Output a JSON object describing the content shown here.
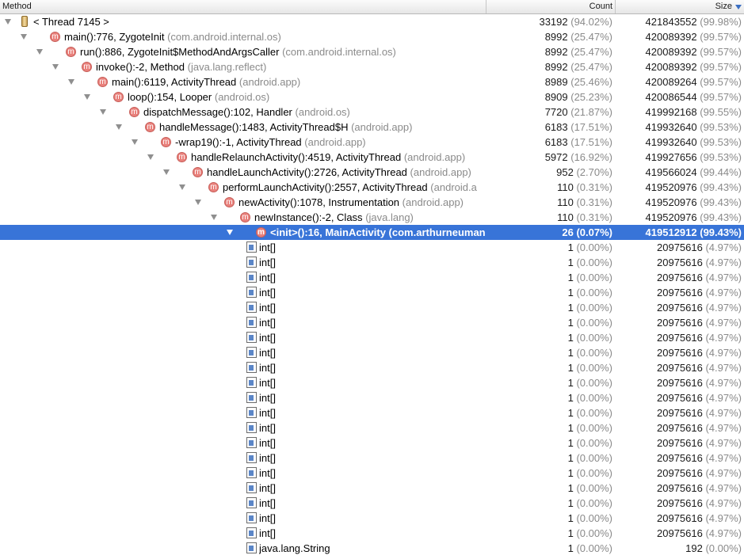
{
  "header": {
    "method": "Method",
    "count": "Count",
    "size": "Size"
  },
  "rows": [
    {
      "level": 0,
      "expanded": true,
      "icon": "thread-icon",
      "name": "< Thread 7145 >",
      "pkg": "",
      "count": "33192",
      "count_pct": "(94.02%)",
      "size": "421843552",
      "size_pct": "(99.98%)"
    },
    {
      "level": 1,
      "expanded": true,
      "icon": "method-icon",
      "name": "main():776, ZygoteInit",
      "pkg": "(com.android.internal.os)",
      "count": "8992",
      "count_pct": "(25.47%)",
      "size": "420089392",
      "size_pct": "(99.57%)"
    },
    {
      "level": 2,
      "expanded": true,
      "icon": "method-icon",
      "name": "run():886, ZygoteInit$MethodAndArgsCaller",
      "pkg": "(com.android.internal.os)",
      "count": "8992",
      "count_pct": "(25.47%)",
      "size": "420089392",
      "size_pct": "(99.57%)"
    },
    {
      "level": 3,
      "expanded": true,
      "icon": "method-icon",
      "name": "invoke():-2, Method",
      "pkg": "(java.lang.reflect)",
      "count": "8992",
      "count_pct": "(25.47%)",
      "size": "420089392",
      "size_pct": "(99.57%)"
    },
    {
      "level": 4,
      "expanded": true,
      "icon": "method-icon",
      "name": "main():6119, ActivityThread",
      "pkg": "(android.app)",
      "count": "8989",
      "count_pct": "(25.46%)",
      "size": "420089264",
      "size_pct": "(99.57%)"
    },
    {
      "level": 5,
      "expanded": true,
      "icon": "method-icon",
      "name": "loop():154, Looper",
      "pkg": "(android.os)",
      "count": "8909",
      "count_pct": "(25.23%)",
      "size": "420086544",
      "size_pct": "(99.57%)"
    },
    {
      "level": 6,
      "expanded": true,
      "icon": "method-icon",
      "name": "dispatchMessage():102, Handler",
      "pkg": "(android.os)",
      "count": "7720",
      "count_pct": "(21.87%)",
      "size": "419992168",
      "size_pct": "(99.55%)"
    },
    {
      "level": 7,
      "expanded": true,
      "icon": "method-icon",
      "name": "handleMessage():1483, ActivityThread$H",
      "pkg": "(android.app)",
      "count": "6183",
      "count_pct": "(17.51%)",
      "size": "419932640",
      "size_pct": "(99.53%)"
    },
    {
      "level": 8,
      "expanded": true,
      "icon": "method-icon",
      "name": "-wrap19():-1, ActivityThread",
      "pkg": "(android.app)",
      "count": "6183",
      "count_pct": "(17.51%)",
      "size": "419932640",
      "size_pct": "(99.53%)"
    },
    {
      "level": 9,
      "expanded": true,
      "icon": "method-icon",
      "name": "handleRelaunchActivity():4519, ActivityThread",
      "pkg": "(android.app)",
      "count": "5972",
      "count_pct": "(16.92%)",
      "size": "419927656",
      "size_pct": "(99.53%)"
    },
    {
      "level": 10,
      "expanded": true,
      "icon": "method-icon",
      "name": "handleLaunchActivity():2726, ActivityThread",
      "pkg": "(android.app)",
      "count": "952",
      "count_pct": "(2.70%)",
      "size": "419566024",
      "size_pct": "(99.44%)"
    },
    {
      "level": 11,
      "expanded": true,
      "icon": "method-icon",
      "name": "performLaunchActivity():2557, ActivityThread",
      "pkg": "(android.a",
      "count": "110",
      "count_pct": "(0.31%)",
      "size": "419520976",
      "size_pct": "(99.43%)"
    },
    {
      "level": 12,
      "expanded": true,
      "icon": "method-icon",
      "name": "newActivity():1078, Instrumentation",
      "pkg": "(android.app)",
      "count": "110",
      "count_pct": "(0.31%)",
      "size": "419520976",
      "size_pct": "(99.43%)"
    },
    {
      "level": 13,
      "expanded": true,
      "icon": "method-icon",
      "name": "newInstance():-2, Class",
      "pkg": "(java.lang)",
      "count": "110",
      "count_pct": "(0.31%)",
      "size": "419520976",
      "size_pct": "(99.43%)"
    },
    {
      "level": 14,
      "expanded": true,
      "icon": "method-icon",
      "name": "<init>():16, MainActivity",
      "pkg": "(com.arthurneuman.n",
      "count": "26",
      "count_pct": "(0.07%)",
      "size": "419512912",
      "size_pct": "(99.43%)",
      "selected": true
    },
    {
      "level": 15,
      "expanded": false,
      "icon": "object-icon",
      "name": "int[]",
      "pkg": "",
      "count": "1",
      "count_pct": "(0.00%)",
      "size": "20975616",
      "size_pct": "(4.97%)"
    },
    {
      "level": 15,
      "expanded": false,
      "icon": "object-icon",
      "name": "int[]",
      "pkg": "",
      "count": "1",
      "count_pct": "(0.00%)",
      "size": "20975616",
      "size_pct": "(4.97%)"
    },
    {
      "level": 15,
      "expanded": false,
      "icon": "object-icon",
      "name": "int[]",
      "pkg": "",
      "count": "1",
      "count_pct": "(0.00%)",
      "size": "20975616",
      "size_pct": "(4.97%)"
    },
    {
      "level": 15,
      "expanded": false,
      "icon": "object-icon",
      "name": "int[]",
      "pkg": "",
      "count": "1",
      "count_pct": "(0.00%)",
      "size": "20975616",
      "size_pct": "(4.97%)"
    },
    {
      "level": 15,
      "expanded": false,
      "icon": "object-icon",
      "name": "int[]",
      "pkg": "",
      "count": "1",
      "count_pct": "(0.00%)",
      "size": "20975616",
      "size_pct": "(4.97%)"
    },
    {
      "level": 15,
      "expanded": false,
      "icon": "object-icon",
      "name": "int[]",
      "pkg": "",
      "count": "1",
      "count_pct": "(0.00%)",
      "size": "20975616",
      "size_pct": "(4.97%)"
    },
    {
      "level": 15,
      "expanded": false,
      "icon": "object-icon",
      "name": "int[]",
      "pkg": "",
      "count": "1",
      "count_pct": "(0.00%)",
      "size": "20975616",
      "size_pct": "(4.97%)"
    },
    {
      "level": 15,
      "expanded": false,
      "icon": "object-icon",
      "name": "int[]",
      "pkg": "",
      "count": "1",
      "count_pct": "(0.00%)",
      "size": "20975616",
      "size_pct": "(4.97%)"
    },
    {
      "level": 15,
      "expanded": false,
      "icon": "object-icon",
      "name": "int[]",
      "pkg": "",
      "count": "1",
      "count_pct": "(0.00%)",
      "size": "20975616",
      "size_pct": "(4.97%)"
    },
    {
      "level": 15,
      "expanded": false,
      "icon": "object-icon",
      "name": "int[]",
      "pkg": "",
      "count": "1",
      "count_pct": "(0.00%)",
      "size": "20975616",
      "size_pct": "(4.97%)"
    },
    {
      "level": 15,
      "expanded": false,
      "icon": "object-icon",
      "name": "int[]",
      "pkg": "",
      "count": "1",
      "count_pct": "(0.00%)",
      "size": "20975616",
      "size_pct": "(4.97%)"
    },
    {
      "level": 15,
      "expanded": false,
      "icon": "object-icon",
      "name": "int[]",
      "pkg": "",
      "count": "1",
      "count_pct": "(0.00%)",
      "size": "20975616",
      "size_pct": "(4.97%)"
    },
    {
      "level": 15,
      "expanded": false,
      "icon": "object-icon",
      "name": "int[]",
      "pkg": "",
      "count": "1",
      "count_pct": "(0.00%)",
      "size": "20975616",
      "size_pct": "(4.97%)"
    },
    {
      "level": 15,
      "expanded": false,
      "icon": "object-icon",
      "name": "int[]",
      "pkg": "",
      "count": "1",
      "count_pct": "(0.00%)",
      "size": "20975616",
      "size_pct": "(4.97%)"
    },
    {
      "level": 15,
      "expanded": false,
      "icon": "object-icon",
      "name": "int[]",
      "pkg": "",
      "count": "1",
      "count_pct": "(0.00%)",
      "size": "20975616",
      "size_pct": "(4.97%)"
    },
    {
      "level": 15,
      "expanded": false,
      "icon": "object-icon",
      "name": "int[]",
      "pkg": "",
      "count": "1",
      "count_pct": "(0.00%)",
      "size": "20975616",
      "size_pct": "(4.97%)"
    },
    {
      "level": 15,
      "expanded": false,
      "icon": "object-icon",
      "name": "int[]",
      "pkg": "",
      "count": "1",
      "count_pct": "(0.00%)",
      "size": "20975616",
      "size_pct": "(4.97%)"
    },
    {
      "level": 15,
      "expanded": false,
      "icon": "object-icon",
      "name": "int[]",
      "pkg": "",
      "count": "1",
      "count_pct": "(0.00%)",
      "size": "20975616",
      "size_pct": "(4.97%)"
    },
    {
      "level": 15,
      "expanded": false,
      "icon": "object-icon",
      "name": "int[]",
      "pkg": "",
      "count": "1",
      "count_pct": "(0.00%)",
      "size": "20975616",
      "size_pct": "(4.97%)"
    },
    {
      "level": 15,
      "expanded": false,
      "icon": "object-icon",
      "name": "int[]",
      "pkg": "",
      "count": "1",
      "count_pct": "(0.00%)",
      "size": "20975616",
      "size_pct": "(4.97%)"
    },
    {
      "level": 15,
      "expanded": false,
      "icon": "object-icon",
      "name": "java.lang.String",
      "pkg": "",
      "count": "1",
      "count_pct": "(0.00%)",
      "size": "192",
      "size_pct": "(0.00%)"
    }
  ]
}
